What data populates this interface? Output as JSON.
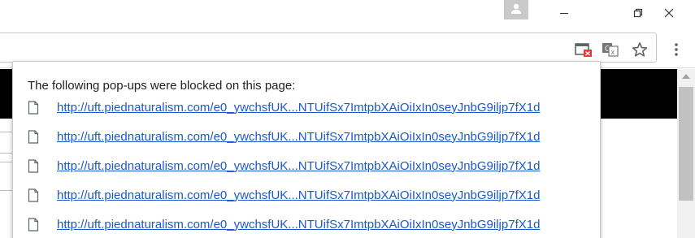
{
  "window": {
    "icons": {
      "profile": "person-icon",
      "minimize": "minimize-icon",
      "restore": "restore-icon",
      "close": "close-icon"
    }
  },
  "toolbar": {
    "icons": {
      "popup_blocked": "popup-blocked-icon",
      "translate": "translate-icon",
      "bookmark": "star-icon",
      "menu": "kebab-menu-icon"
    },
    "colors": {
      "popup_blocked_badge": "#e53935"
    }
  },
  "bubble": {
    "title": "The following pop-ups were blocked on this page:",
    "link_color": "#1a58cc",
    "popups": [
      {
        "url": "http://uft.piednaturalism.com/e0_ywchsfUK...NTUifSx7ImtpbXAiOiIxIn0seyJnbG9iljp7fX1d"
      },
      {
        "url": "http://uft.piednaturalism.com/e0_ywchsfUK...NTUifSx7ImtpbXAiOiIxIn0seyJnbG9iljp7fX1d"
      },
      {
        "url": "http://uft.piednaturalism.com/e0_ywchsfUK...NTUifSx7ImtpbXAiOiIxIn0seyJnbG9iljp7fX1d"
      },
      {
        "url": "http://uft.piednaturalism.com/e0_ywchsfUK...NTUifSx7ImtpbXAiOiIxIn0seyJnbG9iljp7fX1d"
      },
      {
        "url": "http://uft.piednaturalism.com/e0_ywchsfUK...NTUifSx7ImtpbXAiOiIxIn0seyJnbG9iljp7fX1d"
      }
    ]
  }
}
